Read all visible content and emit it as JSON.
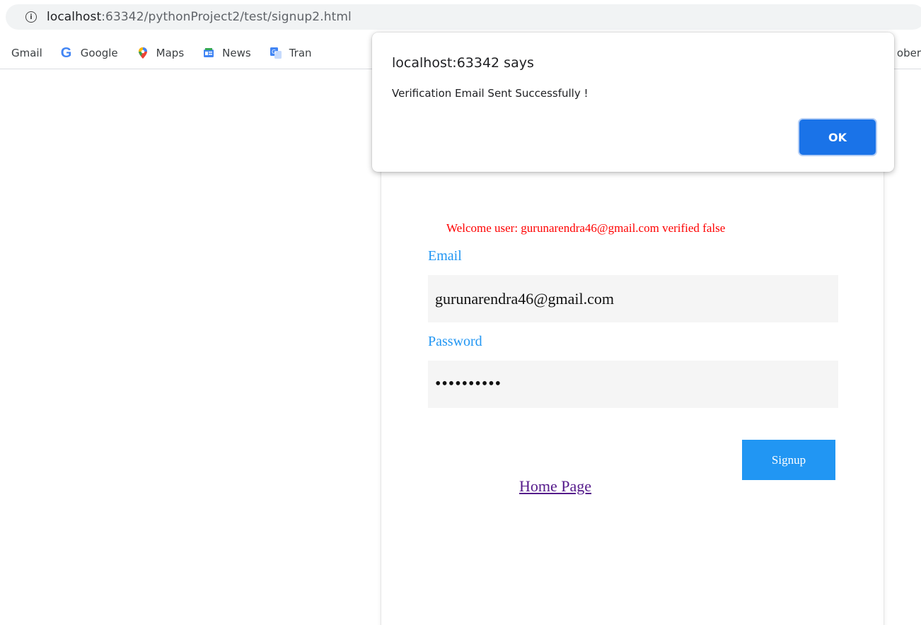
{
  "browser": {
    "url_host": "localhost",
    "url_rest": ":63342/pythonProject2/test/signup2.html"
  },
  "bookmarks": {
    "items": [
      {
        "label": "Gmail",
        "icon": "none"
      },
      {
        "label": "Google",
        "icon": "google-g-icon"
      },
      {
        "label": "Maps",
        "icon": "maps-pin-icon"
      },
      {
        "label": "News",
        "icon": "news-icon"
      },
      {
        "label": "Tran",
        "icon": "translate-icon"
      }
    ],
    "right_partial": "ober"
  },
  "dialog": {
    "title": "localhost:63342 says",
    "message": "Verification Email Sent Successfully !",
    "ok_label": "OK"
  },
  "form": {
    "welcome": "Welcome user: gurunarendra46@gmail.com verified false",
    "email_label": "Email",
    "email_value": "gurunarendra46@gmail.com",
    "password_label": "Password",
    "password_value": "••••••••••",
    "signup_label": "Signup",
    "home_link": "Home Page"
  },
  "colors": {
    "accent": "#2196f3",
    "welcome_text": "#ff0000",
    "dialog_button": "#1a73e8",
    "link_visited": "#551a8b"
  }
}
